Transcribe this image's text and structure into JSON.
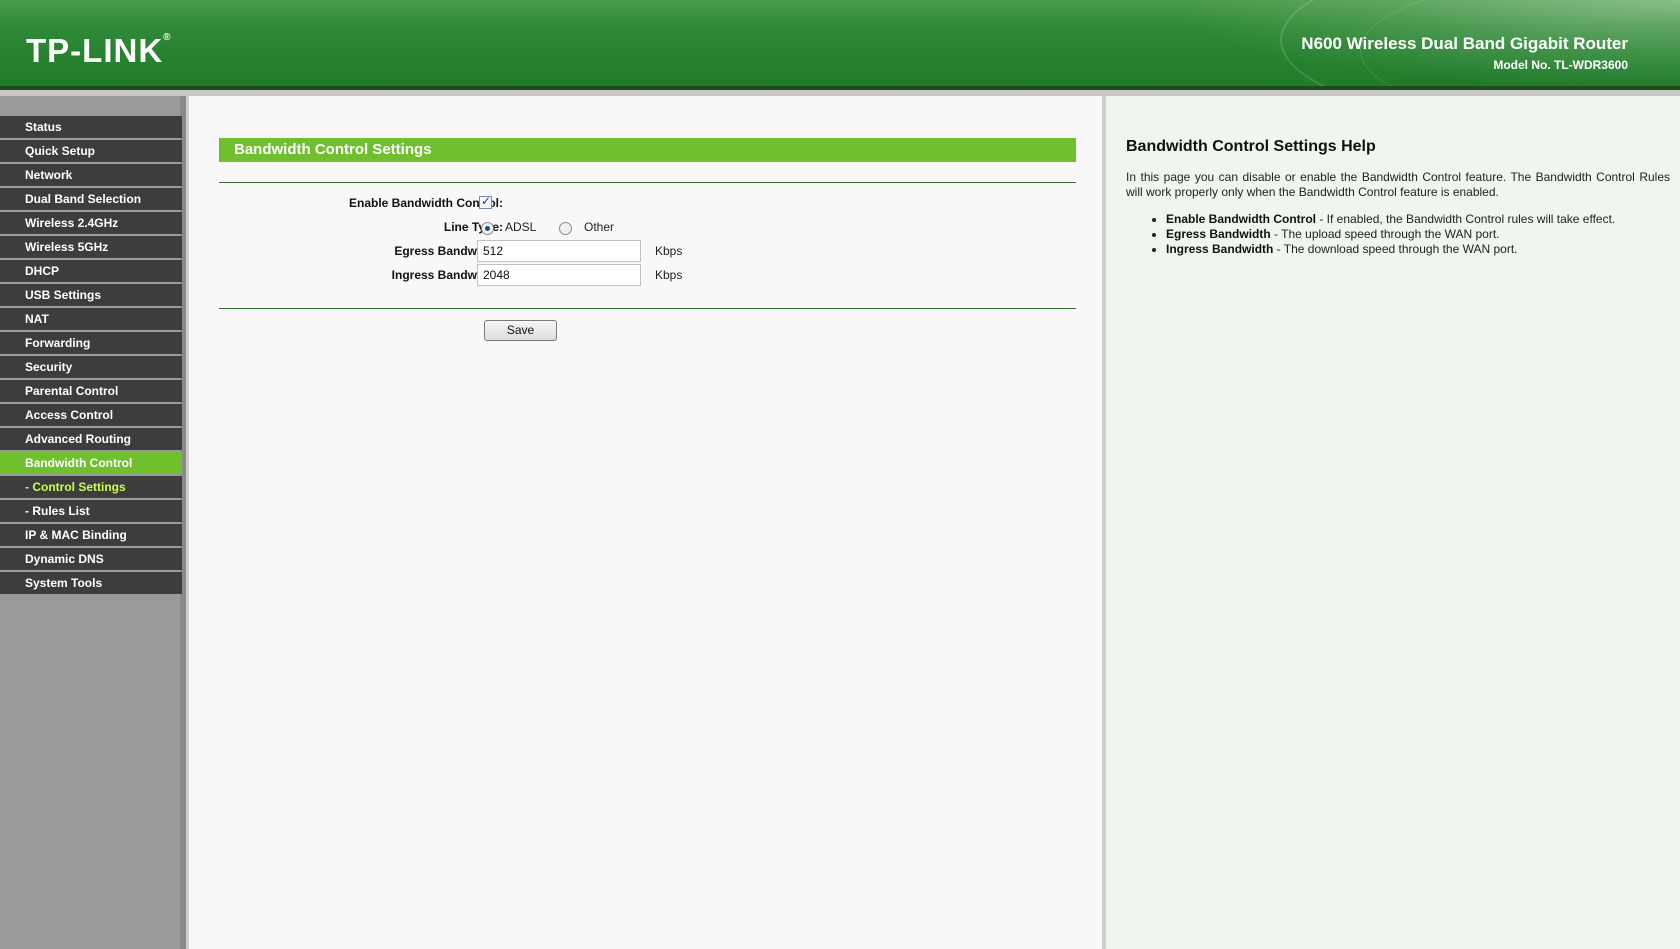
{
  "header": {
    "logo": "TP-LINK",
    "logo_mark": "®",
    "product_name": "N600 Wireless Dual Band Gigabit Router",
    "model_no": "Model No. TL-WDR3600"
  },
  "sidebar": {
    "items": [
      {
        "label": "Status",
        "state": "normal"
      },
      {
        "label": "Quick Setup",
        "state": "normal"
      },
      {
        "label": "Network",
        "state": "normal"
      },
      {
        "label": "Dual Band Selection",
        "state": "normal"
      },
      {
        "label": "Wireless 2.4GHz",
        "state": "normal"
      },
      {
        "label": "Wireless 5GHz",
        "state": "normal"
      },
      {
        "label": "DHCP",
        "state": "normal"
      },
      {
        "label": "USB Settings",
        "state": "normal"
      },
      {
        "label": "NAT",
        "state": "normal"
      },
      {
        "label": "Forwarding",
        "state": "normal"
      },
      {
        "label": "Security",
        "state": "normal"
      },
      {
        "label": "Parental Control",
        "state": "normal"
      },
      {
        "label": "Access Control",
        "state": "normal"
      },
      {
        "label": "Advanced Routing",
        "state": "normal"
      },
      {
        "label": "Bandwidth Control",
        "state": "active"
      },
      {
        "label": "- Control Settings",
        "state": "sub-active"
      },
      {
        "label": "- Rules List",
        "state": "sub"
      },
      {
        "label": "IP & MAC Binding",
        "state": "normal"
      },
      {
        "label": "Dynamic DNS",
        "state": "normal"
      },
      {
        "label": "System Tools",
        "state": "normal"
      }
    ]
  },
  "main": {
    "title": "Bandwidth Control Settings",
    "enable_label": "Enable Bandwidth Control:",
    "enable_checked": true,
    "line_type_label": "Line Type:",
    "line_type_options": [
      "ADSL",
      "Other"
    ],
    "line_type_selected": "ADSL",
    "egress_label": "Egress Bandwidth:",
    "egress_value": "512",
    "ingress_label": "Ingress Bandwidth:",
    "ingress_value": "2048",
    "unit": "Kbps",
    "save_label": "Save"
  },
  "help": {
    "title": "Bandwidth Control Settings Help",
    "intro": "In this page you can disable or enable the Bandwidth Control feature. The Bandwidth Control Rules will work properly only when the Bandwidth Control feature is enabled.",
    "items": [
      {
        "term": "Enable Bandwidth Control",
        "desc": " - If enabled, the Bandwidth Control rules will take effect."
      },
      {
        "term": "Egress Bandwidth",
        "desc": " - The upload speed through the WAN port."
      },
      {
        "term": "Ingress Bandwidth",
        "desc": " - The download speed through the WAN port."
      }
    ]
  },
  "colors": {
    "header_green": "#2f8a36",
    "active_green": "#6fbf2f",
    "menu_dark": "#3d3d3d",
    "sub_active_text": "#c8ff50"
  }
}
